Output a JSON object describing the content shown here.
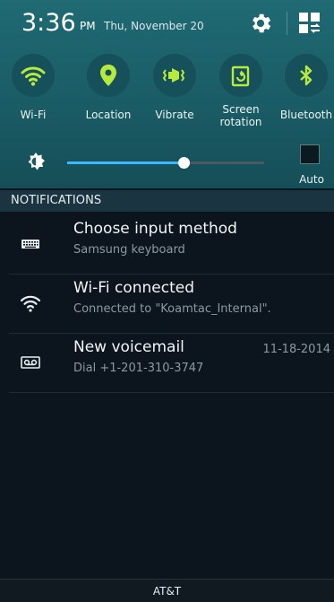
{
  "status": {
    "time": "3:36",
    "ampm": "PM",
    "date": "Thu, November 20",
    "settings_icon": "gear-icon",
    "edit_icon": "grid-edit-icon"
  },
  "quick_settings": {
    "accent_color": "#b6ea3f",
    "items": [
      {
        "label": "Wi-Fi",
        "icon": "wifi-icon",
        "active": true
      },
      {
        "label": "Location",
        "icon": "location-pin-icon",
        "active": true
      },
      {
        "label": "Vibrate",
        "icon": "vibrate-icon",
        "active": true
      },
      {
        "label": "Screen\nrotation",
        "icon": "screen-rotation-icon",
        "active": true
      },
      {
        "label": "Bluetooth",
        "icon": "bluetooth-icon",
        "active": true
      }
    ]
  },
  "brightness": {
    "icon": "brightness-icon",
    "level": 0.59,
    "auto_label": "Auto",
    "auto_checked": false
  },
  "notifications": {
    "header": "NOTIFICATIONS",
    "items": [
      {
        "icon": "keyboard-icon",
        "title": "Choose input method",
        "subtitle": "Samsung keyboard",
        "time": ""
      },
      {
        "icon": "wifi-icon",
        "title": "Wi-Fi connected",
        "subtitle": "Connected to \"Koamtac_Internal\".",
        "time": ""
      },
      {
        "icon": "voicemail-icon",
        "title": "New voicemail",
        "subtitle": "Dial +1-201-310-3747",
        "time": "11-18-2014"
      }
    ]
  },
  "carrier": "AT&T"
}
